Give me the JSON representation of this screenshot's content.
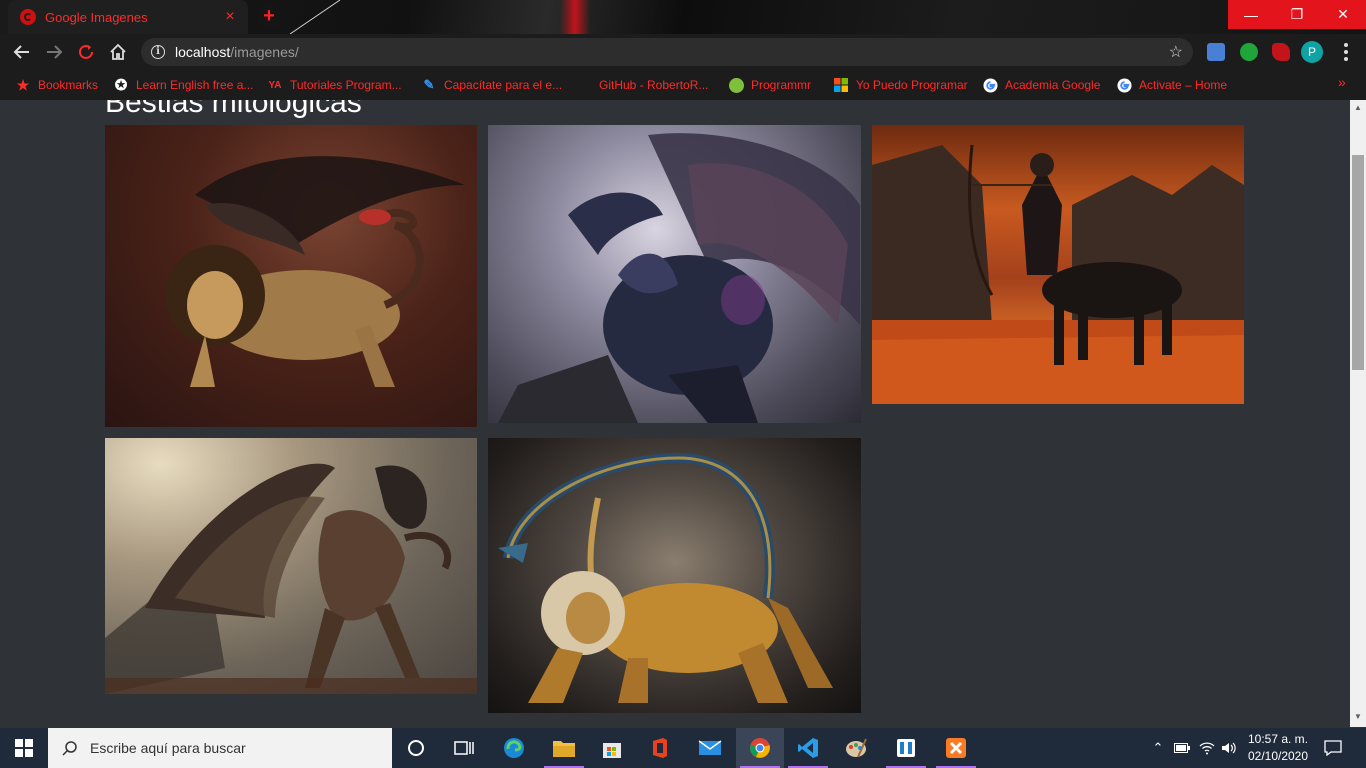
{
  "browser": {
    "tab_title": "Google Imagenes",
    "tab_close": "×",
    "new_tab": "+",
    "address_host": "localhost",
    "address_path": "/imagenes/",
    "profile_initial": "P",
    "window_controls": {
      "minimize": "—",
      "restore": "❐",
      "close": "✕"
    }
  },
  "bookmarks": [
    {
      "label": "Bookmarks",
      "icon": "star-icon"
    },
    {
      "label": "Learn English free a...",
      "icon": "star-badge-icon"
    },
    {
      "label": "Tutoriales Program...",
      "icon": "ya-icon"
    },
    {
      "label": "Capacítate para el e...",
      "icon": "edit-icon"
    },
    {
      "label": "GitHub - RobertoR...",
      "icon": "github-icon"
    },
    {
      "label": "Programmr",
      "icon": "programmr-icon"
    },
    {
      "label": "Yo Puedo Programar",
      "icon": "microsoft-icon"
    },
    {
      "label": "Academia Google",
      "icon": "google-icon"
    },
    {
      "label": "Activate – Home",
      "icon": "google-icon"
    }
  ],
  "page": {
    "heading": "Bestias mitologicas",
    "images": [
      {
        "alt": "manticore"
      },
      {
        "alt": "dragon"
      },
      {
        "alt": "centaur"
      },
      {
        "alt": "griffin"
      },
      {
        "alt": "chimera"
      }
    ]
  },
  "taskbar": {
    "search_placeholder": "Escribe aquí para buscar",
    "time": "10:57 a. m.",
    "date": "02/10/2020"
  },
  "colors": {
    "accent_red": "#ff2a2a",
    "page_bg": "#2f3237",
    "taskbar_bg": "#1f2a3a"
  }
}
